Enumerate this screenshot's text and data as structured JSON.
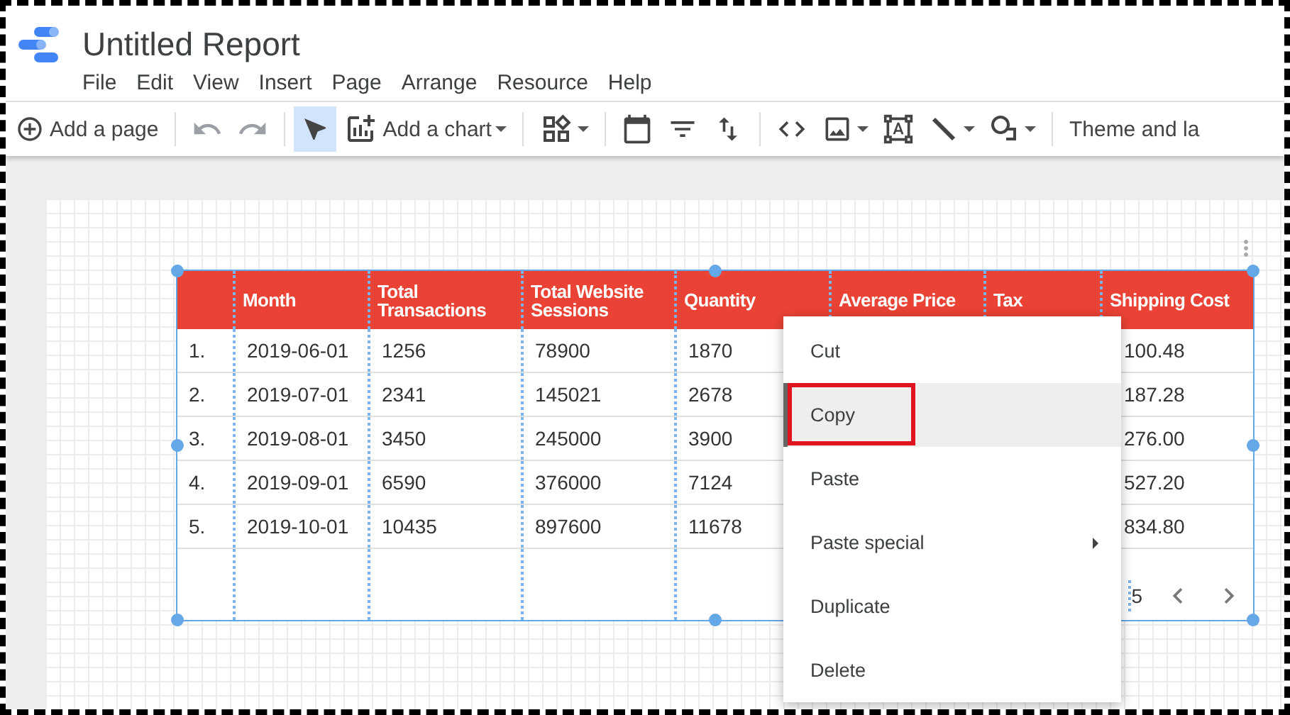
{
  "header": {
    "title": "Untitled Report",
    "menu": [
      "File",
      "Edit",
      "View",
      "Insert",
      "Page",
      "Arrange",
      "Resource",
      "Help"
    ]
  },
  "toolbar": [
    {
      "kind": "add-page",
      "label": "Add a page",
      "selected": false,
      "dropdown": false
    },
    {
      "kind": "separator"
    },
    {
      "kind": "undo",
      "selected": false,
      "dropdown": false
    },
    {
      "kind": "redo",
      "selected": false,
      "dropdown": false
    },
    {
      "kind": "separator"
    },
    {
      "kind": "select",
      "selected": true,
      "dropdown": false
    },
    {
      "kind": "add-chart",
      "label": "Add a chart",
      "selected": false,
      "dropdown": true
    },
    {
      "kind": "separator"
    },
    {
      "kind": "controls",
      "selected": false,
      "dropdown": true
    },
    {
      "kind": "separator"
    },
    {
      "kind": "date-range",
      "selected": false,
      "dropdown": false
    },
    {
      "kind": "filter",
      "selected": false,
      "dropdown": false
    },
    {
      "kind": "data-control",
      "selected": false,
      "dropdown": false
    },
    {
      "kind": "separator"
    },
    {
      "kind": "url-embed",
      "selected": false,
      "dropdown": false
    },
    {
      "kind": "image",
      "selected": false,
      "dropdown": true
    },
    {
      "kind": "text",
      "selected": false,
      "dropdown": false
    },
    {
      "kind": "line",
      "selected": false,
      "dropdown": true
    },
    {
      "kind": "shape",
      "selected": false,
      "dropdown": true
    },
    {
      "kind": "separator"
    },
    {
      "kind": "theme",
      "label": "Theme and la",
      "selected": false,
      "dropdown": false
    }
  ],
  "table": {
    "columns": [
      "Month",
      "Total Transactions",
      "Total Website Sessions",
      "Quantity",
      "Average Price",
      "Tax",
      "Shipping Cost"
    ],
    "rows": [
      {
        "number": "1.",
        "month": "2019-06-01",
        "total_transactions": "1256",
        "total_website_sessions": "78900",
        "quantity": "1870",
        "shipping_cost": "100.48"
      },
      {
        "number": "2.",
        "month": "2019-07-01",
        "total_transactions": "2341",
        "total_website_sessions": "145021",
        "quantity": "2678",
        "shipping_cost": "187.28"
      },
      {
        "number": "3.",
        "month": "2019-08-01",
        "total_transactions": "3450",
        "total_website_sessions": "245000",
        "quantity": "3900",
        "shipping_cost": "276.00"
      },
      {
        "number": "4.",
        "month": "2019-09-01",
        "total_transactions": "6590",
        "total_website_sessions": "376000",
        "quantity": "7124",
        "shipping_cost": "527.20"
      },
      {
        "number": "5.",
        "month": "2019-10-01",
        "total_transactions": "10435",
        "total_website_sessions": "897600",
        "quantity": "11678",
        "shipping_cost": "834.80"
      }
    ],
    "pagination": {
      "page_text": "5"
    }
  },
  "context_menu": [
    {
      "label": "Cut",
      "selected": false,
      "submenu": false,
      "annotated": false
    },
    {
      "label": "Copy",
      "selected": true,
      "submenu": false,
      "annotated": true
    },
    {
      "label": "Paste",
      "selected": false,
      "submenu": false,
      "annotated": false
    },
    {
      "label": "Paste special",
      "selected": false,
      "submenu": true,
      "annotated": false
    },
    {
      "label": "Duplicate",
      "selected": false,
      "submenu": false,
      "annotated": false
    },
    {
      "label": "Delete",
      "selected": false,
      "submenu": false,
      "annotated": false
    }
  ]
}
